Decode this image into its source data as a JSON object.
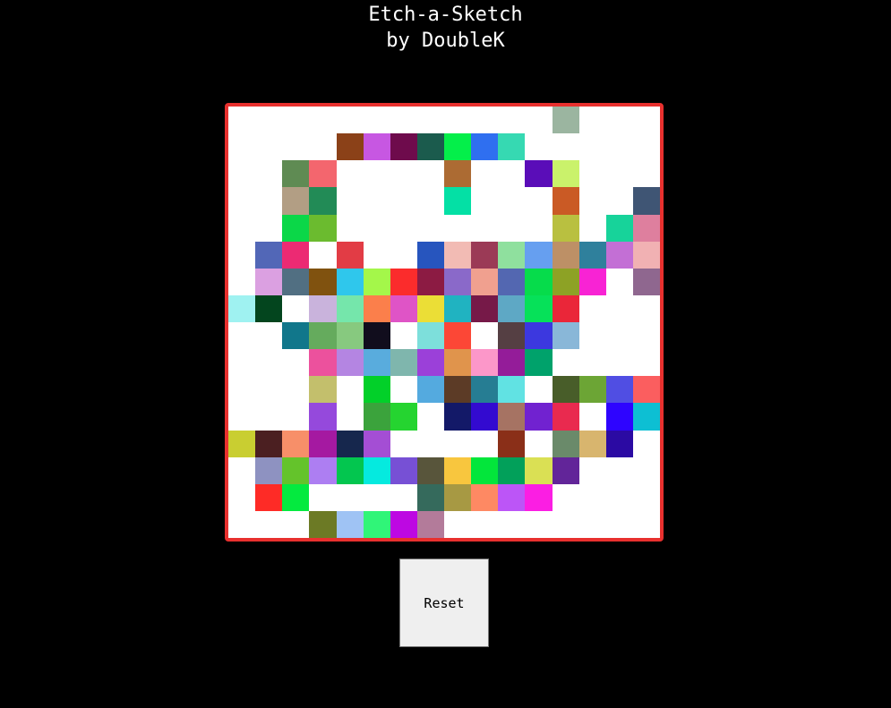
{
  "header": {
    "title": "Etch-a-Sketch",
    "subtitle": "by DoubleK"
  },
  "board": {
    "border_color": "#e8302e",
    "background": "#ffffff",
    "rows": [
      [
        "#ffffff",
        "#ffffff",
        "#ffffff",
        "#ffffff",
        "#ffffff",
        "#ffffff",
        "#ffffff",
        "#ffffff",
        "#ffffff",
        "#ffffff",
        "#ffffff",
        "#ffffff",
        "#9bb5a0",
        "#ffffff",
        "#ffffff",
        "#ffffff"
      ],
      [
        "#ffffff",
        "#ffffff",
        "#ffffff",
        "#ffffff",
        "#8b4118",
        "#c757e2",
        "#6e0b4c",
        "#1b5b4d",
        "#04ef4a",
        "#2f6ff0",
        "#36d9b2",
        "#ffffff",
        "#ffffff",
        "#ffffff",
        "#ffffff",
        "#ffffff"
      ],
      [
        "#ffffff",
        "#ffffff",
        "#5f8b53",
        "#f3666e",
        "#ffffff",
        "#ffffff",
        "#ffffff",
        "#ffffff",
        "#ac6b33",
        "#ffffff",
        "#ffffff",
        "#5a0db8",
        "#caf26b",
        "#ffffff",
        "#ffffff",
        "#ffffff"
      ],
      [
        "#ffffff",
        "#ffffff",
        "#b29e84",
        "#228b56",
        "#ffffff",
        "#ffffff",
        "#ffffff",
        "#ffffff",
        "#04e0a5",
        "#ffffff",
        "#ffffff",
        "#ffffff",
        "#ca5a25",
        "#ffffff",
        "#ffffff",
        "#3f5574"
      ],
      [
        "#ffffff",
        "#ffffff",
        "#0bd748",
        "#6bbb2f",
        "#ffffff",
        "#ffffff",
        "#ffffff",
        "#ffffff",
        "#ffffff",
        "#ffffff",
        "#ffffff",
        "#ffffff",
        "#b9c040",
        "#ffffff",
        "#17d39a",
        "#de7f9e"
      ],
      [
        "#ffffff",
        "#5267b7",
        "#ec2a73",
        "#ffffff",
        "#e23c45",
        "#ffffff",
        "#ffffff",
        "#2755be",
        "#f2bbb4",
        "#9b3a56",
        "#8fe09e",
        "#669ff0",
        "#bd9066",
        "#2f809c",
        "#c36fd5",
        "#f1b1b3"
      ],
      [
        "#ffffff",
        "#dba0e1",
        "#516f82",
        "#80520f",
        "#2fc7ec",
        "#a4f74a",
        "#fb2c2c",
        "#8c1b43",
        "#8a69c9",
        "#f0a08f",
        "#5367b1",
        "#06dc4b",
        "#8da225",
        "#f823d4",
        "#ffffff",
        "#8f678f"
      ],
      [
        "#9ff2f1",
        "#03451e",
        "#ffffff",
        "#c9b3dc",
        "#75e6ab",
        "#fb7f4b",
        "#df54c6",
        "#ebde36",
        "#20b3c1",
        "#761948",
        "#5ea8c5",
        "#06e159",
        "#ea2639",
        "#ffffff",
        "#ffffff",
        "#ffffff"
      ],
      [
        "#ffffff",
        "#ffffff",
        "#11778b",
        "#65ab5d",
        "#87c97f",
        "#110d1d",
        "#ffffff",
        "#7ddfdb",
        "#fc4736",
        "#ffffff",
        "#553f43",
        "#3c38df",
        "#89b7d8",
        "#ffffff",
        "#ffffff",
        "#ffffff"
      ],
      [
        "#ffffff",
        "#ffffff",
        "#ffffff",
        "#ec519d",
        "#b485e2",
        "#59acdd",
        "#7fb6ad",
        "#9b40d9",
        "#e0944c",
        "#fc97c9",
        "#941c99",
        "#00a26b",
        "#ffffff",
        "#ffffff",
        "#ffffff",
        "#ffffff"
      ],
      [
        "#ffffff",
        "#ffffff",
        "#ffffff",
        "#c3bf6c",
        "#ffffff",
        "#02d029",
        "#ffffff",
        "#54aadf",
        "#5c3b26",
        "#267d93",
        "#61e2e3",
        "#ffffff",
        "#485d29",
        "#6ca535",
        "#504ee3",
        "#fb5e5f"
      ],
      [
        "#ffffff",
        "#ffffff",
        "#ffffff",
        "#9549dc",
        "#ffffff",
        "#3ba33c",
        "#25d430",
        "#ffffff",
        "#131968",
        "#330ad0",
        "#a67363",
        "#7122d0",
        "#e92a4f",
        "#ffffff",
        "#2e04ff",
        "#0dbfd3"
      ],
      [
        "#c9ce31",
        "#4b1f21",
        "#f78f69",
        "#a519a1",
        "#16274d",
        "#a44ed4",
        "#ffffff",
        "#ffffff",
        "#ffffff",
        "#ffffff",
        "#8a2f18",
        "#ffffff",
        "#6a8a6a",
        "#d8b56e",
        "#2b0aa3",
        "#ffffff"
      ],
      [
        "#ffffff",
        "#8e92c1",
        "#64c32b",
        "#ad7ef2",
        "#03c64f",
        "#05eadf",
        "#7750d5",
        "#58553b",
        "#f8c63e",
        "#03e63b",
        "#02a05a",
        "#dae054",
        "#622599",
        "#ffffff",
        "#ffffff",
        "#ffffff"
      ],
      [
        "#ffffff",
        "#fe2b26",
        "#04ea3f",
        "#ffffff",
        "#ffffff",
        "#ffffff",
        "#ffffff",
        "#356a5c",
        "#a79943",
        "#fe8963",
        "#bc55f7",
        "#fb1ee3",
        "#ffffff",
        "#ffffff",
        "#ffffff",
        "#ffffff"
      ],
      [
        "#ffffff",
        "#ffffff",
        "#ffffff",
        "#6c7a25",
        "#9fc3f4",
        "#30f578",
        "#bd08e2",
        "#b37b9a",
        "#ffffff",
        "#ffffff",
        "#ffffff",
        "#ffffff",
        "#ffffff",
        "#ffffff",
        "#ffffff",
        "#ffffff"
      ]
    ]
  },
  "controls": {
    "reset_label": "Reset"
  }
}
